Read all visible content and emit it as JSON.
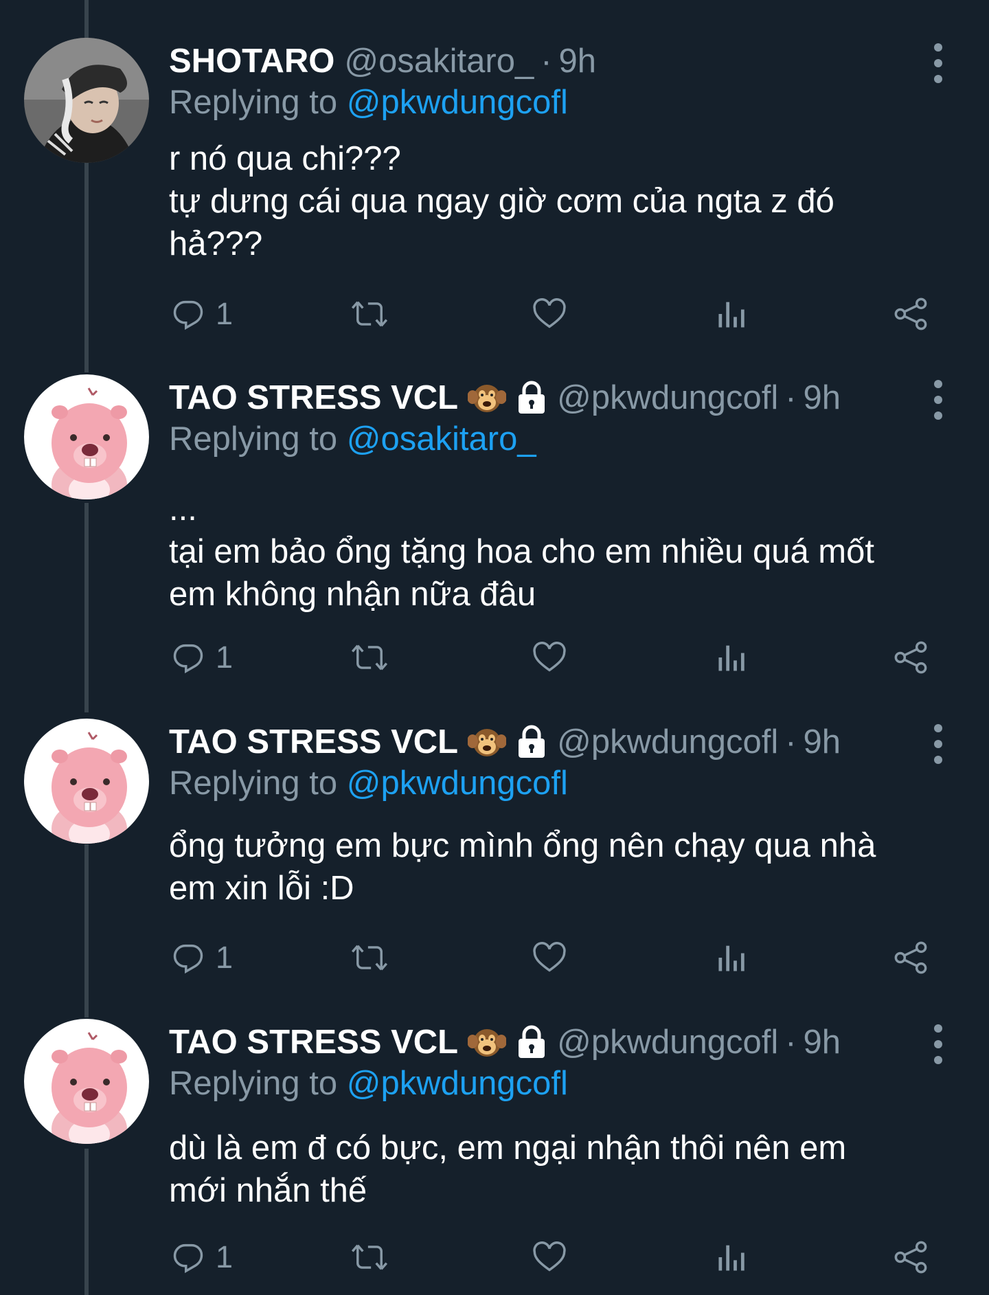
{
  "tweets": [
    {
      "name": "SHOTARO",
      "handle": "@osakitaro_",
      "dot": "·",
      "time": "9h",
      "reply_prefix": "Replying to",
      "reply_target": "@pkwdungcofl",
      "lines": [
        "r nó qua chi???",
        "tự dưng cái qua ngay giờ cơm của ngta z đó",
        "hả???"
      ],
      "reply_count": "1",
      "avatar": "person-photo",
      "badges": []
    },
    {
      "name": "TAO STRESS VCL",
      "handle": "@pkwdungcofl",
      "dot": "·",
      "time": "9h",
      "reply_prefix": "Replying to",
      "reply_target": "@osakitaro_",
      "lines": [
        "...",
        "tại em bảo ổng tặng hoa cho em nhiều quá mốt",
        "em không nhận nữa đâu"
      ],
      "reply_count": "1",
      "avatar": "pink-beaver",
      "badges": [
        "monkey-emoji",
        "lock-icon"
      ]
    },
    {
      "name": "TAO STRESS VCL",
      "handle": "@pkwdungcofl",
      "dot": "·",
      "time": "9h",
      "reply_prefix": "Replying to",
      "reply_target": "@pkwdungcofl",
      "lines": [
        "ổng tưởng em bực mình ổng nên chạy qua nhà",
        "em xin lỗi :D"
      ],
      "reply_count": "1",
      "avatar": "pink-beaver",
      "badges": [
        "monkey-emoji",
        "lock-icon"
      ]
    },
    {
      "name": "TAO STRESS VCL",
      "handle": "@pkwdungcofl",
      "dot": "·",
      "time": "9h",
      "reply_prefix": "Replying to",
      "reply_target": "@pkwdungcofl",
      "lines": [
        "dù là em đ có bực, em ngại nhận thôi nên em",
        "mới nhắn thế"
      ],
      "reply_count": "1",
      "avatar": "pink-beaver",
      "badges": [
        "monkey-emoji",
        "lock-icon"
      ]
    }
  ],
  "colors": {
    "background": "#15202b",
    "secondary_text": "#8899a6",
    "link": "#1da1f2",
    "thread_line": "#38444d"
  },
  "icons": {
    "reply": "reply-icon",
    "retweet": "retweet-icon",
    "like": "like-icon",
    "analytics": "analytics-icon",
    "share": "share-icon",
    "more": "more-icon"
  }
}
